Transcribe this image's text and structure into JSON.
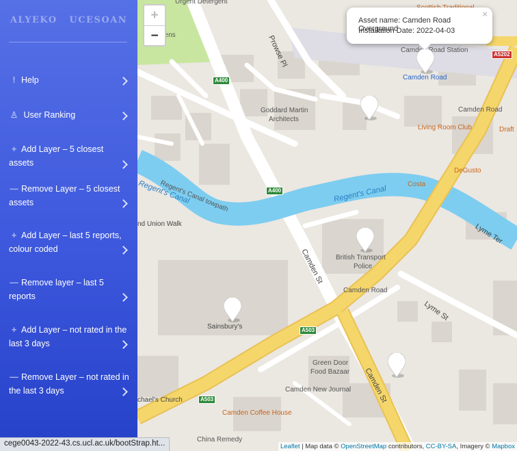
{
  "sidebar": {
    "brand_left": "ALYEKO",
    "brand_right": "UCESOAN",
    "items": [
      {
        "icon": "!",
        "icon_name": "exclamation-icon",
        "label": "Help"
      },
      {
        "icon": "♙",
        "icon_name": "user-icon",
        "label": "User Ranking"
      },
      {
        "icon": "+",
        "icon_name": "plus-icon",
        "label": "Add Layer – 5 closest assets"
      },
      {
        "icon": "—",
        "icon_name": "minus-icon",
        "label": "Remove Layer – 5 closest assets"
      },
      {
        "icon": "+",
        "icon_name": "plus-icon",
        "label": "Add Layer – last 5 reports, colour coded"
      },
      {
        "icon": "—",
        "icon_name": "minus-icon",
        "label": "Remove layer – last 5 reports"
      },
      {
        "icon": "+",
        "icon_name": "plus-icon",
        "label": "Add Layer – not rated in the last 3 days"
      },
      {
        "icon": "—",
        "icon_name": "minus-icon",
        "label": "Remove Layer – not rated in the last 3 days"
      }
    ]
  },
  "map": {
    "zoom_in": "+",
    "zoom_out": "−",
    "popup": {
      "asset_name": "Asset name: Camden Road Overground",
      "installation_date": "Installation Date: 2022-04-03",
      "close": "×"
    },
    "labels": {
      "urgent_detergent": "Urgent Detergent",
      "scottish_traditional": "Scottish Traditional",
      "gardens": "dens",
      "prowse_pl": "Prowse Pl",
      "camden_road_station": "Camden Road Station",
      "camden_road_blue": "Camden Road",
      "a5202": "A5202",
      "goddard_1": "Goddard Martin",
      "goddard_2": "Architects",
      "camden_road_1": "Camden Road",
      "living_room_club": "Living Room Club",
      "draft": "Draft",
      "degusto": "DeGusto",
      "costa": "Costa",
      "regents_canal_left": "Regent's Canal",
      "regents_canal_towpath": "Regent's Canal towpath",
      "regents_canal_right": "Regent's Canal",
      "a400_top": "A400",
      "a400_mid": "A400",
      "a503": "A503",
      "a503_b": "A503",
      "union_walk": "nd Union Walk",
      "lyme_ter": "Lyme Ter",
      "btp_1": "British Transport",
      "btp_2": "Police",
      "camden_road_2": "Camden Road",
      "camden_st_1": "Camden St",
      "lyme_st": "Lyme St",
      "sainsburys": "Sainsbury's",
      "green_door_1": "Green Door",
      "green_door_2": "Food Bazaar",
      "camden_new_journal": "Camden New Journal",
      "camden_st_2": "Camden St",
      "church": "chael's Church",
      "camden_coffee_house": "Camden Coffee House",
      "china_remedy": "China Remedy"
    },
    "attribution": {
      "leaflet": "Leaflet",
      "sep1": " | Map data © ",
      "osm": "OpenStreetMap",
      "contributors": " contributors, ",
      "ccbysa": "CC-BY-SA",
      "imagery": ", Imagery © ",
      "mapbox": "Mapbox"
    }
  },
  "statusbar": {
    "url": "cege0043-2022-43.cs.ucl.ac.uk/bootStrap.ht..."
  },
  "colors": {
    "sidebar_top": "#5670e6",
    "sidebar_bottom": "#2541c8",
    "road_major": "#f3cf5b",
    "canal": "#7dcdf0",
    "park": "#c8e6a0"
  }
}
